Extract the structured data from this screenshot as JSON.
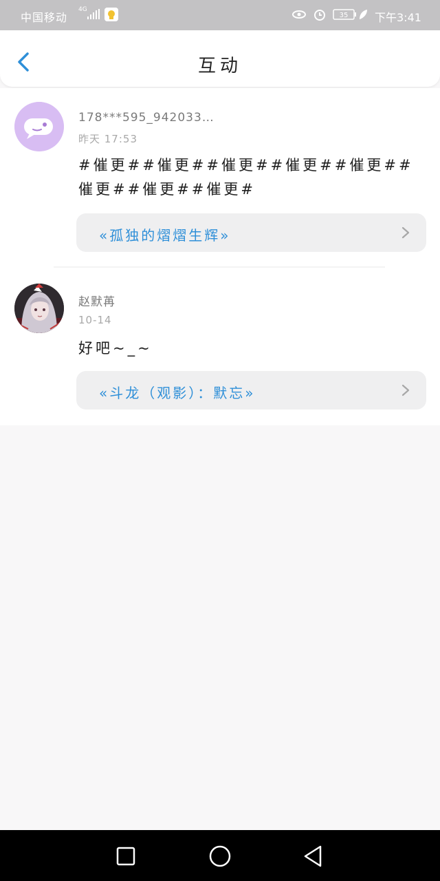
{
  "status_bar": {
    "carrier": "中国移动",
    "network": "4G",
    "battery": "35",
    "time": "下午3:41"
  },
  "header": {
    "title": "互动"
  },
  "comments": [
    {
      "user": "178***595_942033…",
      "time": "昨天 17:53",
      "text": "#催更##催更##催更##催更##催更##催更##催更##催更#",
      "book": "«孤独的熠熠生辉»",
      "avatar_icon": "chat-bubble-icon"
    },
    {
      "user": "赵默苒",
      "time": "10-14",
      "text": "好吧~_~",
      "book": "«斗龙（观影）：默忘»",
      "avatar_icon": "anime-girl-avatar"
    }
  ],
  "colors": {
    "accent": "#2e8fd8",
    "status_bar": "#c3c2c4",
    "link_background": "#efeff0",
    "page_background": "#f8f7f8"
  },
  "icons": {
    "back": "chevron-left-icon",
    "link_arrow": "chevron-right-icon",
    "nav_recent": "square-icon",
    "nav_home": "circle-icon",
    "nav_back": "triangle-back-icon"
  }
}
